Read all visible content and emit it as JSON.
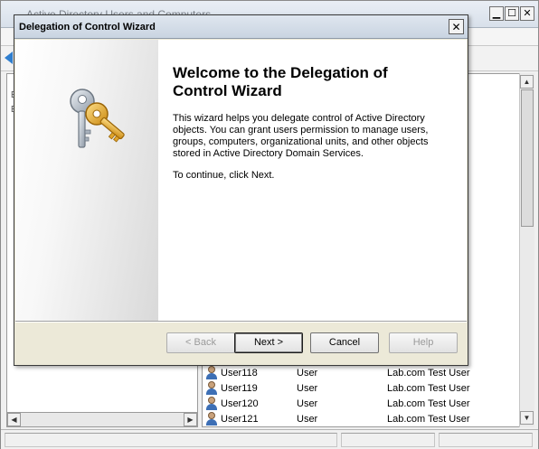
{
  "background_window": {
    "title": "Active Directory Users and Computers",
    "controls": {
      "minimize": "▁",
      "maximize": "☐",
      "close": "✕"
    },
    "tree_glyphs": [
      "E",
      "E"
    ],
    "scroll": {
      "up": "▲",
      "down": "▼",
      "left": "◀",
      "right": "▶"
    },
    "list": {
      "rows": [
        {
          "name": "User118",
          "type": "User",
          "description": "Lab.com Test User"
        },
        {
          "name": "User119",
          "type": "User",
          "description": "Lab.com Test User"
        },
        {
          "name": "User120",
          "type": "User",
          "description": "Lab.com Test User"
        },
        {
          "name": "User121",
          "type": "User",
          "description": "Lab.com Test User"
        }
      ]
    }
  },
  "wizard": {
    "title": "Delegation of Control Wizard",
    "close_glyph": "✕",
    "icon": "keys-icon",
    "heading": "Welcome to the Delegation of Control Wizard",
    "description": "This wizard helps you delegate control of Active Directory objects. You can grant users permission to manage users, groups, computers, organizational units, and other objects stored in Active Directory Domain Services.",
    "continue_text": "To continue, click Next.",
    "buttons": {
      "back": "< Back",
      "next": "Next >",
      "cancel": "Cancel",
      "help": "Help"
    }
  },
  "colors": {
    "accent_blue": "#2f7fd0",
    "key_gold": "#e8a81c",
    "key_silver": "#b9c2cc"
  }
}
